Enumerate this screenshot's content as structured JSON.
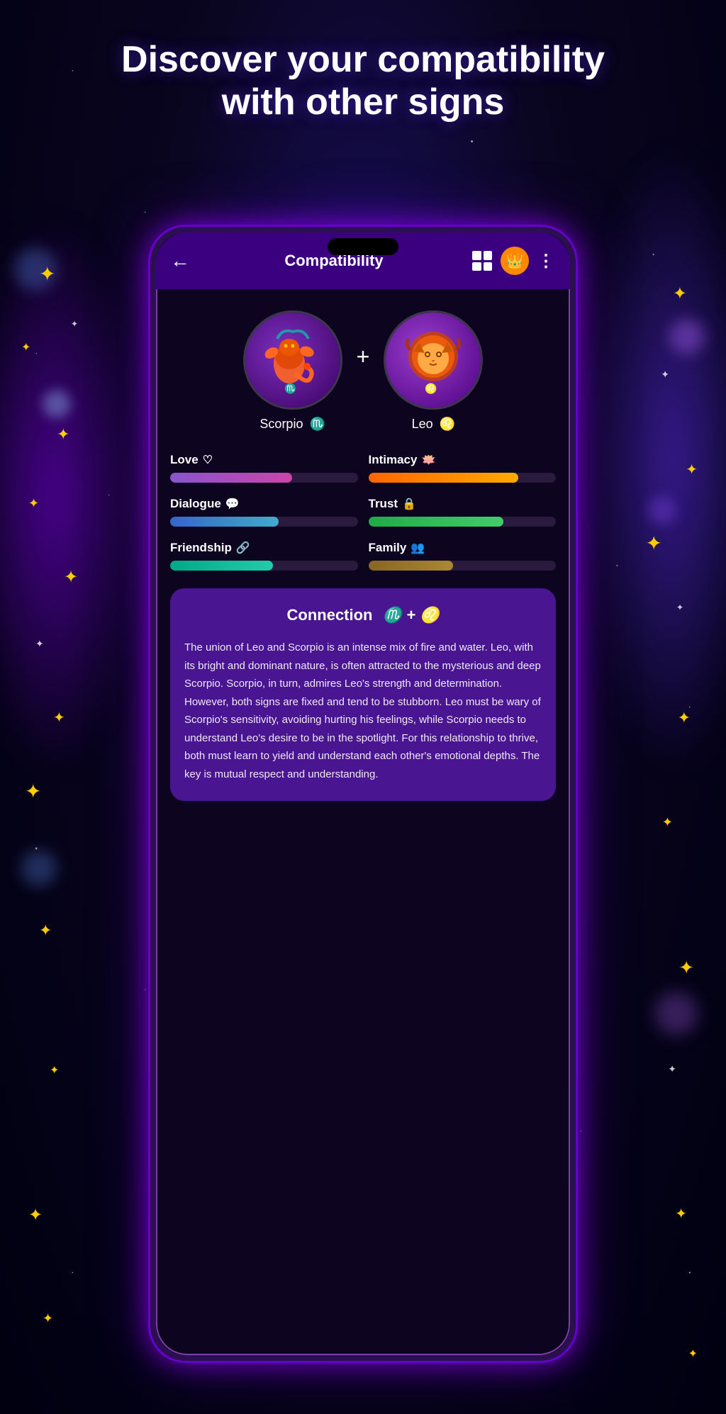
{
  "background": {
    "heading_line1": "Discover your compatibility",
    "heading_line2": "with other signs"
  },
  "app": {
    "header": {
      "title": "Compatibility",
      "back_label": "←",
      "dots_label": "⋮"
    },
    "signs": {
      "sign1": {
        "name": "Scorpio",
        "symbol": "♏"
      },
      "sign2": {
        "name": "Leo",
        "symbol": "♌"
      },
      "separator": "+"
    },
    "metrics": [
      {
        "id": "love",
        "label": "Love",
        "icon": "♡",
        "bar_class": "bar-love"
      },
      {
        "id": "intimacy",
        "label": "Intimacy",
        "icon": "🪷",
        "bar_class": "bar-intimacy"
      },
      {
        "id": "dialogue",
        "label": "Dialogue",
        "icon": "💬",
        "bar_class": "bar-dialogue"
      },
      {
        "id": "trust",
        "label": "Trust",
        "icon": "🔒",
        "bar_class": "bar-trust"
      },
      {
        "id": "friendship",
        "label": "Friendship",
        "icon": "🔗",
        "bar_class": "bar-friendship"
      },
      {
        "id": "family",
        "label": "Family",
        "icon": "👥",
        "bar_class": "bar-family"
      }
    ],
    "connection": {
      "title": "Connection",
      "symbols": "♏ + ♌",
      "text": "The union of Leo and Scorpio is an intense mix of fire and water. Leo, with its bright and dominant nature, is often attracted to the mysterious and deep Scorpio. Scorpio, in turn, admires Leo's strength and determination. However, both signs are fixed and tend to be stubborn. Leo must be wary of Scorpio's sensitivity, avoiding hurting his feelings, while Scorpio needs to understand Leo's desire to be in the spotlight. For this relationship to thrive, both must learn to yield and understand each other's emotional depths. The key is mutual respect and understanding."
    }
  }
}
